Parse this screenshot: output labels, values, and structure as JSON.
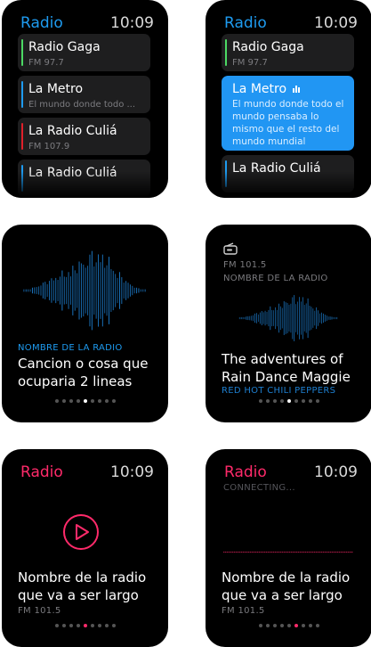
{
  "colors": {
    "accent_blue": "#1e9bf0",
    "accent_pink": "#ff2a6a",
    "card_bg": "#1e1e1f",
    "active_card": "#2196f3"
  },
  "screen1": {
    "title": "Radio",
    "time": "10:09",
    "stations": [
      {
        "name": "Radio Gaga",
        "sub": "FM 97.7",
        "color": "#4cd964"
      },
      {
        "name": "La Metro",
        "sub": "El mundo donde todo ...",
        "color": "#1e9bf0"
      },
      {
        "name": "La Radio Culiá",
        "sub": "FM 107.9",
        "color": "#e0202a"
      },
      {
        "name": "La Radio Culiá",
        "color": "#1e9bf0"
      }
    ]
  },
  "screen2": {
    "title": "Radio",
    "time": "10:09",
    "stations": [
      {
        "name": "Radio Gaga",
        "sub": "FM 97.7",
        "color": "#4cd964"
      },
      {
        "name": "La Metro",
        "desc": "El mundo donde todo el mundo pensaba lo mismo que el resto del mundo mundial",
        "icon": "equalizer-icon"
      },
      {
        "name": "La Radio Culiá",
        "color": "#1e9bf0"
      }
    ]
  },
  "screen3": {
    "station_label": "NOMBRE DE LA RADIO",
    "song": [
      "Cancion o cosa que",
      "ocuparia 2 lineas"
    ],
    "page_count": 9,
    "page_active": 5
  },
  "screen4": {
    "icon": "radio-icon",
    "freq": "FM 101.5",
    "station_label": "NOMBRE DE LA RADIO",
    "song": [
      "The adventures of",
      "Rain Dance Maggie"
    ],
    "artist": "RED HOT CHILI PEPPERS",
    "page_count": 9,
    "page_active": 5
  },
  "screen5": {
    "title": "Radio",
    "time": "10:09",
    "play_icon": "play-icon",
    "name": [
      "Nombre de la radio",
      "que va a ser largo"
    ],
    "freq": "FM 101.5",
    "page_count": 9,
    "page_active": 5
  },
  "screen6": {
    "title": "Radio",
    "time": "10:09",
    "status": "CONNECTING...",
    "name": [
      "Nombre de la radio",
      "que va a ser largo"
    ],
    "freq": "FM 101.5",
    "page_count": 9,
    "page_active": 6
  }
}
